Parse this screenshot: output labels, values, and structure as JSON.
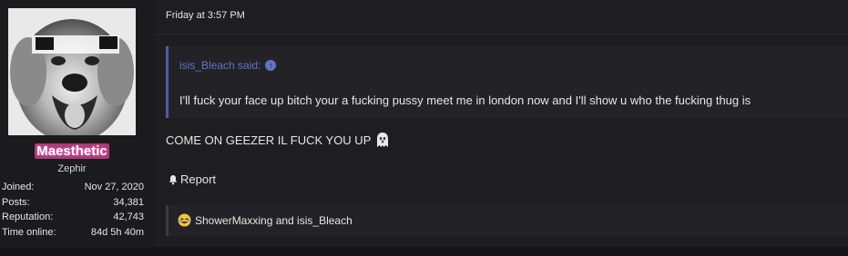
{
  "user": {
    "name": "Maesthetic",
    "title": "Zephir",
    "stats": [
      {
        "label": "Joined:",
        "value": "Nov 27, 2020"
      },
      {
        "label": "Posts:",
        "value": "34,381"
      },
      {
        "label": "Reputation:",
        "value": "42,743"
      },
      {
        "label": "Time online:",
        "value": "84d 5h 40m"
      }
    ],
    "name_color": "#a83a78"
  },
  "post": {
    "date": "Friday at 3:57 PM",
    "quote": {
      "author": "isis_Bleach said:",
      "text": "I'll fuck your face up bitch your a fucking pussy meet me in london now and I'll show u who the fucking thug is"
    },
    "message": "COME ON GEEZER IL FUCK YOU UP",
    "report_label": "Report",
    "reactions_text": "ShowerMaxxing and isis_Bleach"
  },
  "icons": {
    "quote_link": "arrow-up-circle-icon",
    "message_emoji": "ghost-icon",
    "report": "bell-icon",
    "reaction": "laughing-emoji-icon"
  },
  "colors": {
    "quote_accent": "#4a5ea8",
    "quote_author": "#5f73c8"
  }
}
